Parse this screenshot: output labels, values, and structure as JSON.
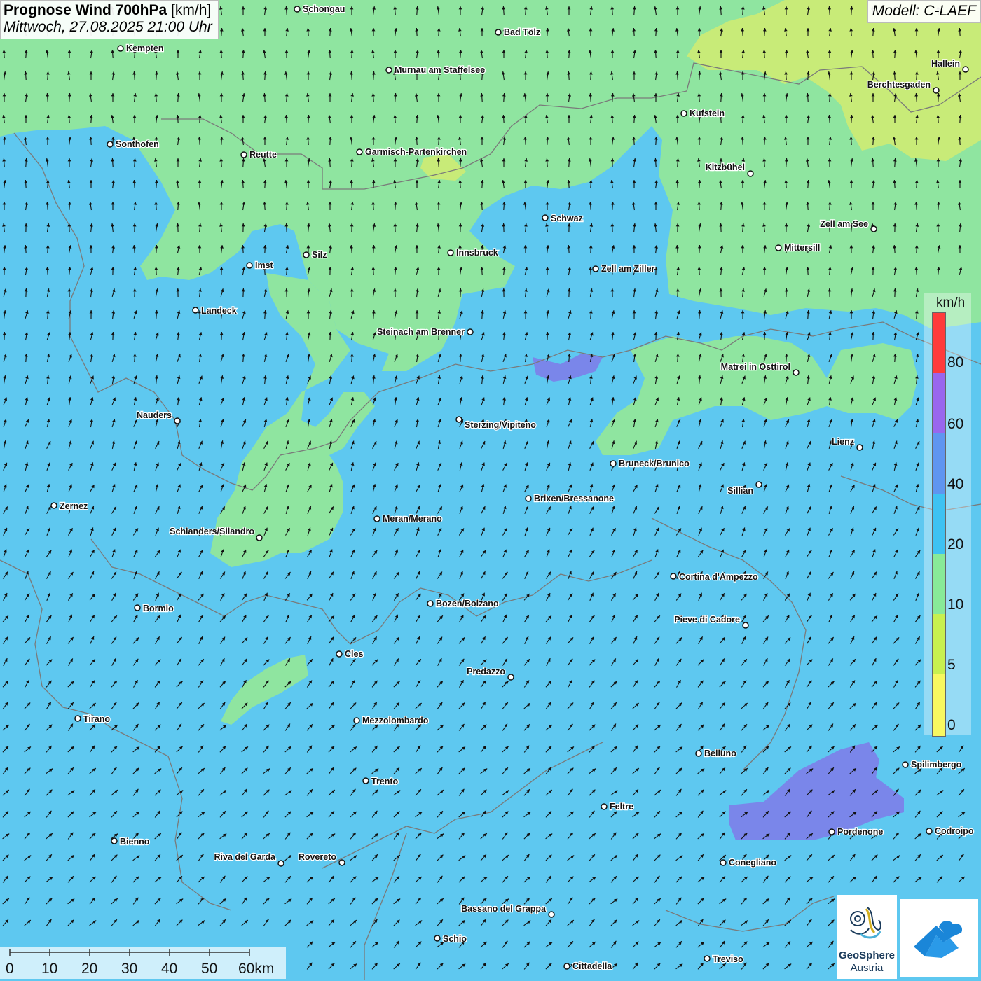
{
  "header": {
    "title_bold": "Prognose Wind 700hPa",
    "title_unit": "[km/h]",
    "subtitle": "Mittwoch, 27.08.2025 21:00 Uhr",
    "model": "Modell: C-LAEF"
  },
  "legend": {
    "unit": "km/h",
    "labels": [
      "80",
      "60",
      "40",
      "20",
      "10",
      "5",
      "0"
    ],
    "colors": [
      "#ff3b3b",
      "#9966ee",
      "#5f95f0",
      "#3ec2f2",
      "#88ea98",
      "#c8f050",
      "#f8f860"
    ]
  },
  "colors": {
    "blue_background": "#5ec8f0",
    "green_zone": "#8fe5a0",
    "yellow_green_zone": "#c8eb78",
    "purple_zone": "#7a86ea",
    "border_line": "#7a7a7a"
  },
  "scale": {
    "labels": [
      "0",
      "10",
      "20",
      "30",
      "40",
      "50",
      "60km"
    ]
  },
  "cities": [
    {
      "name": "Schongau"
    },
    {
      "name": "Bad Tölz"
    },
    {
      "name": "Kempten"
    },
    {
      "name": "Murnau am Staffelsee"
    },
    {
      "name": "Hallein"
    },
    {
      "name": "Berchtesgaden"
    },
    {
      "name": "Kufstein"
    },
    {
      "name": "Sonthofen"
    },
    {
      "name": "Reutte"
    },
    {
      "name": "Garmisch-Partenkirchen"
    },
    {
      "name": "Kitzbühel"
    },
    {
      "name": "Schwaz"
    },
    {
      "name": "Zell am See"
    },
    {
      "name": "Mittersill"
    },
    {
      "name": "Silz"
    },
    {
      "name": "Innsbruck"
    },
    {
      "name": "Imst"
    },
    {
      "name": "Zell am Ziller"
    },
    {
      "name": "Landeck"
    },
    {
      "name": "Steinach am Brenner"
    },
    {
      "name": "Matrei in Osttirol"
    },
    {
      "name": "Nauders"
    },
    {
      "name": "Sterzing/Vipiteno"
    },
    {
      "name": "Lienz"
    },
    {
      "name": "Bruneck/Brunico"
    },
    {
      "name": "Sillian"
    },
    {
      "name": "Zernez"
    },
    {
      "name": "Brixen/Bressanone"
    },
    {
      "name": "Meran/Merano"
    },
    {
      "name": "Schlanders/Silandro"
    },
    {
      "name": "Cortina d'Ampezzo"
    },
    {
      "name": "Bormio"
    },
    {
      "name": "Bozen/Bolzano"
    },
    {
      "name": "Pieve di Cadore"
    },
    {
      "name": "Cles"
    },
    {
      "name": "Predazzo"
    },
    {
      "name": "Tirano"
    },
    {
      "name": "Mezzolombardo"
    },
    {
      "name": "Belluno"
    },
    {
      "name": "Spilimbergo"
    },
    {
      "name": "Trento"
    },
    {
      "name": "Feltre"
    },
    {
      "name": "Pordenone"
    },
    {
      "name": "Codroipo"
    },
    {
      "name": "Bienno"
    },
    {
      "name": "Riva del Garda"
    },
    {
      "name": "Rovereto"
    },
    {
      "name": "Conegliano"
    },
    {
      "name": "Bassano del Grappa"
    },
    {
      "name": "Schio"
    },
    {
      "name": "Treviso"
    },
    {
      "name": "Cittadella"
    }
  ],
  "logo": {
    "name": "GeoSphere",
    "sub": "Austria"
  }
}
